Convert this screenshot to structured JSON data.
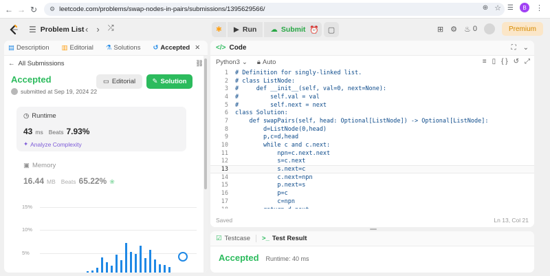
{
  "browser": {
    "url": "leetcode.com/problems/swap-nodes-in-pairs/submissions/1395629566/",
    "profile_initial": "B"
  },
  "header": {
    "problem_list_label": "Problem List",
    "run_label": "Run",
    "submit_label": "Submit",
    "streak_count": "0",
    "premium_label": "Premium"
  },
  "left": {
    "tabs": [
      {
        "label": "Description"
      },
      {
        "label": "Editorial"
      },
      {
        "label": "Solutions"
      },
      {
        "label": "Accepted"
      }
    ],
    "back_label": "All Submissions",
    "status": "Accepted",
    "submitted_text": "submitted at Sep 19, 2024 22",
    "editorial_btn": "Editorial",
    "solution_btn": "Solution",
    "runtime": {
      "label": "Runtime",
      "value": "43",
      "unit": "ms",
      "beats_label": "Beats",
      "beats_value": "7.93%",
      "analyze_label": "Analyze Complexity"
    },
    "memory": {
      "label": "Memory",
      "value": "16.44",
      "unit": "MB",
      "beats_label": "Beats",
      "beats_value": "65.22%"
    }
  },
  "chart_data": {
    "type": "bar",
    "y_ticks": [
      "15%",
      "10%",
      "5%"
    ],
    "ylim": [
      0,
      15
    ],
    "values": [
      0.3,
      0.5,
      1.2,
      3.8,
      2.6,
      1.8,
      4.6,
      3.2,
      7.5,
      5.2,
      4.8,
      6.8,
      3.6,
      5.8,
      3.4,
      2.1,
      1.9,
      1.4
    ]
  },
  "editor": {
    "title": "Code",
    "language": "Python3",
    "mode": "Auto",
    "status_left": "Saved",
    "status_right": "Ln 13, Col 21",
    "lines": [
      {
        "num": "1",
        "text": "# Definition for singly-linked list."
      },
      {
        "num": "2",
        "text": "# class ListNode:"
      },
      {
        "num": "3",
        "text": "#     def __init__(self, val=0, next=None):"
      },
      {
        "num": "4",
        "text": "#         self.val = val"
      },
      {
        "num": "5",
        "text": "#         self.next = next"
      },
      {
        "num": "6",
        "text": "class Solution:"
      },
      {
        "num": "7",
        "text": "    def swapPairs(self, head: Optional[ListNode]) -> Optional[ListNode]:"
      },
      {
        "num": "8",
        "text": "        d=ListNode(0,head)"
      },
      {
        "num": "9",
        "text": "        p,c=d,head"
      },
      {
        "num": "10",
        "text": "        while c and c.next:"
      },
      {
        "num": "11",
        "text": "            npn=c.next.next"
      },
      {
        "num": "12",
        "text": "            s=c.next"
      },
      {
        "num": "13",
        "text": "            s.next=c"
      },
      {
        "num": "14",
        "text": "            c.next=npn"
      },
      {
        "num": "15",
        "text": "            p.next=s"
      },
      {
        "num": "16",
        "text": "            p=c"
      },
      {
        "num": "17",
        "text": "            c=npn"
      },
      {
        "num": "18",
        "text": "        return d.next"
      }
    ]
  },
  "bottom": {
    "testcase_label": "Testcase",
    "result_label": "Test Result",
    "status": "Accepted",
    "runtime_text": "Runtime: 40 ms"
  },
  "colors": {
    "accent_green": "#2cbb5d",
    "bar_blue": "#1e88e5",
    "premium_text": "#d68b00",
    "analyze_purple": "#7d5bd8"
  }
}
